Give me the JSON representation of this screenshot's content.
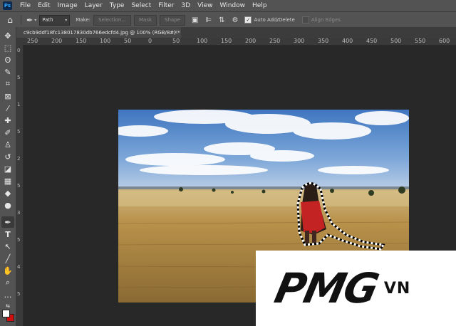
{
  "menubar": {
    "logo": "Ps",
    "items": [
      "File",
      "Edit",
      "Image",
      "Layer",
      "Type",
      "Select",
      "Filter",
      "3D",
      "View",
      "Window",
      "Help"
    ]
  },
  "options": {
    "mode": "Path",
    "make_label": "Make:",
    "selection_btn": "Selection...",
    "mask_btn": "Mask",
    "shape_btn": "Shape",
    "auto_add_delete": "Auto Add/Delete",
    "auto_add_checked": true,
    "align_edges": "Align Edges"
  },
  "document": {
    "tab_title": "c9cb9ddf18fc138017830db766edcfd4.jpg @ 100% (RGB/8#) *"
  },
  "rulers": {
    "horizontal": [
      "250",
      "200",
      "150",
      "100",
      "50",
      "0",
      "50",
      "100",
      "150",
      "200",
      "250",
      "300",
      "350",
      "400",
      "450",
      "500",
      "550",
      "600"
    ],
    "vertical": [
      "0",
      "5",
      "1",
      "5",
      "2",
      "5",
      "3",
      "5",
      "4",
      "5"
    ]
  },
  "tools": [
    {
      "name": "move-tool",
      "glyph": "✥"
    },
    {
      "name": "marquee-tool",
      "glyph": "⬚"
    },
    {
      "name": "lasso-tool",
      "glyph": "ʘ"
    },
    {
      "name": "quick-selection-tool",
      "glyph": "✎"
    },
    {
      "name": "crop-tool",
      "glyph": "⌗"
    },
    {
      "name": "frame-tool",
      "glyph": "⊠"
    },
    {
      "name": "eyedropper-tool",
      "glyph": "⁄"
    },
    {
      "name": "healing-brush-tool",
      "glyph": "✚"
    },
    {
      "name": "brush-tool",
      "glyph": "✐"
    },
    {
      "name": "clone-stamp-tool",
      "glyph": "♙"
    },
    {
      "name": "history-brush-tool",
      "glyph": "↺"
    },
    {
      "name": "eraser-tool",
      "glyph": "◪"
    },
    {
      "name": "gradient-tool",
      "glyph": "▦"
    },
    {
      "name": "blur-tool",
      "glyph": "◆"
    },
    {
      "name": "dodge-tool",
      "glyph": "●"
    },
    {
      "name": "pen-tool",
      "glyph": "✒"
    },
    {
      "name": "type-tool",
      "glyph": "T"
    },
    {
      "name": "path-selection-tool",
      "glyph": "↖"
    },
    {
      "name": "line-tool",
      "glyph": "╱"
    },
    {
      "name": "hand-tool",
      "glyph": "✋"
    },
    {
      "name": "zoom-tool",
      "glyph": "⌕"
    },
    {
      "name": "more-tools",
      "glyph": "…"
    }
  ],
  "watermark": {
    "brand": "PMG",
    "suffix": "VN"
  },
  "colors": {
    "foreground": "#ffffff",
    "background": "#d20d0d"
  }
}
